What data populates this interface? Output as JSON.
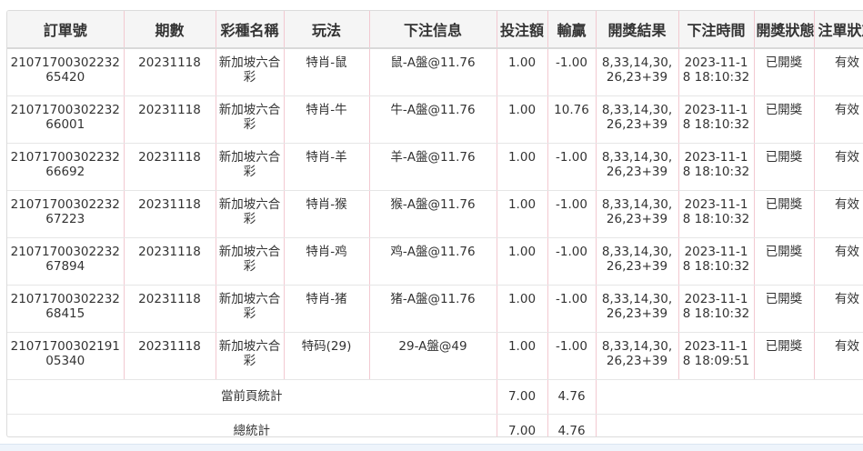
{
  "table": {
    "headers": [
      "訂單號",
      "期數",
      "彩種名稱",
      "玩法",
      "下注信息",
      "投注額",
      "輸贏",
      "開獎結果",
      "下注時間",
      "開獎狀態",
      "注單狀態"
    ],
    "rows": [
      {
        "order": "2107170030223265420",
        "period": "20231118",
        "lottery": "新加坡六合彩",
        "play": "特肖-鼠",
        "bet_info": "鼠-A盤@11.76",
        "amount": "1.00",
        "win_loss": "-1.00",
        "result": "8,33,14,30,26,23+39",
        "time": "2023-11-18 18:10:32",
        "draw_status": "已開獎",
        "bet_status": "有效"
      },
      {
        "order": "2107170030223266001",
        "period": "20231118",
        "lottery": "新加坡六合彩",
        "play": "特肖-牛",
        "bet_info": "牛-A盤@11.76",
        "amount": "1.00",
        "win_loss": "10.76",
        "result": "8,33,14,30,26,23+39",
        "time": "2023-11-18 18:10:32",
        "draw_status": "已開獎",
        "bet_status": "有效"
      },
      {
        "order": "2107170030223266692",
        "period": "20231118",
        "lottery": "新加坡六合彩",
        "play": "特肖-羊",
        "bet_info": "羊-A盤@11.76",
        "amount": "1.00",
        "win_loss": "-1.00",
        "result": "8,33,14,30,26,23+39",
        "time": "2023-11-18 18:10:32",
        "draw_status": "已開獎",
        "bet_status": "有效"
      },
      {
        "order": "2107170030223267223",
        "period": "20231118",
        "lottery": "新加坡六合彩",
        "play": "特肖-猴",
        "bet_info": "猴-A盤@11.76",
        "amount": "1.00",
        "win_loss": "-1.00",
        "result": "8,33,14,30,26,23+39",
        "time": "2023-11-18 18:10:32",
        "draw_status": "已開獎",
        "bet_status": "有效"
      },
      {
        "order": "2107170030223267894",
        "period": "20231118",
        "lottery": "新加坡六合彩",
        "play": "特肖-鸡",
        "bet_info": "鸡-A盤@11.76",
        "amount": "1.00",
        "win_loss": "-1.00",
        "result": "8,33,14,30,26,23+39",
        "time": "2023-11-18 18:10:32",
        "draw_status": "已開獎",
        "bet_status": "有效"
      },
      {
        "order": "2107170030223268415",
        "period": "20231118",
        "lottery": "新加坡六合彩",
        "play": "特肖-猪",
        "bet_info": "猪-A盤@11.76",
        "amount": "1.00",
        "win_loss": "-1.00",
        "result": "8,33,14,30,26,23+39",
        "time": "2023-11-18 18:10:32",
        "draw_status": "已開獎",
        "bet_status": "有效"
      },
      {
        "order": "2107170030219105340",
        "period": "20231118",
        "lottery": "新加坡六合彩",
        "play": "特码(29)",
        "bet_info": "29-A盤@49",
        "amount": "1.00",
        "win_loss": "-1.00",
        "result": "8,33,14,30,26,23+39",
        "time": "2023-11-18 18:09:51",
        "draw_status": "已開獎",
        "bet_status": "有效"
      }
    ],
    "page_total": {
      "label": "當前頁統計",
      "amount": "7.00",
      "win_loss": "4.76"
    },
    "grand_total": {
      "label": "總統計",
      "amount": "7.00",
      "win_loss": "4.76"
    }
  }
}
